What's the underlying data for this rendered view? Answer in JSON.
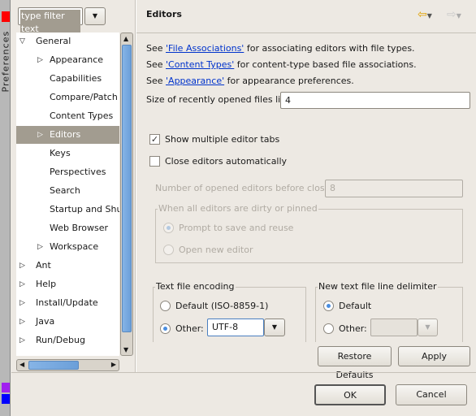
{
  "side_strip": {
    "label": "Preferences",
    "colors": [
      "#ff0000",
      "#a020f0",
      "#0000ff"
    ]
  },
  "filter": {
    "placeholder": "type filter text"
  },
  "tree": [
    {
      "label": "General",
      "level": 0,
      "expanded": true
    },
    {
      "label": "Appearance",
      "level": 1,
      "expandable": true
    },
    {
      "label": "Capabilities",
      "level": 1
    },
    {
      "label": "Compare/Patch",
      "level": 1
    },
    {
      "label": "Content Types",
      "level": 1
    },
    {
      "label": "Editors",
      "level": 1,
      "expandable": true,
      "selected": true
    },
    {
      "label": "Keys",
      "level": 1
    },
    {
      "label": "Perspectives",
      "level": 1
    },
    {
      "label": "Search",
      "level": 1
    },
    {
      "label": "Startup and Shutdown",
      "level": 1
    },
    {
      "label": "Web Browser",
      "level": 1
    },
    {
      "label": "Workspace",
      "level": 1,
      "expandable": true
    },
    {
      "label": "Ant",
      "level": 0,
      "expandable": true
    },
    {
      "label": "Help",
      "level": 0,
      "expandable": true
    },
    {
      "label": "Install/Update",
      "level": 0,
      "expandable": true
    },
    {
      "label": "Java",
      "level": 0,
      "expandable": true
    },
    {
      "label": "Run/Debug",
      "level": 0,
      "expandable": true
    }
  ],
  "page": {
    "title": "Editors",
    "links": [
      {
        "pre": "See ",
        "link": "'File Associations'",
        "post": " for associating editors with file types."
      },
      {
        "pre": "See ",
        "link": "'Content Types'",
        "post": " for content-type based file associations."
      },
      {
        "pre": "See ",
        "link": "'Appearance'",
        "post": " for appearance preferences."
      }
    ],
    "recent_label": "Size of recently opened files list:",
    "recent_value": "4",
    "show_tabs": {
      "label": "Show multiple editor tabs",
      "checked": true
    },
    "close_auto": {
      "label": "Close editors automatically",
      "checked": false
    },
    "num_label": "Number of opened editors before closing:",
    "num_value": "8",
    "dirty_group": {
      "title": "When all editors are dirty or pinned",
      "opt1": "Prompt to save and reuse",
      "opt2": "Open new editor"
    },
    "encoding": {
      "title": "Text file encoding",
      "opt1": "Default (ISO-8859-1)",
      "opt2": "Other:",
      "value": "UTF-8"
    },
    "delimiter": {
      "title": "New text file line delimiter",
      "opt1": "Default",
      "opt2": "Other:",
      "value": ""
    },
    "restore": "Restore Defaults",
    "apply": "Apply"
  },
  "dialog": {
    "ok": "OK",
    "cancel": "Cancel"
  }
}
